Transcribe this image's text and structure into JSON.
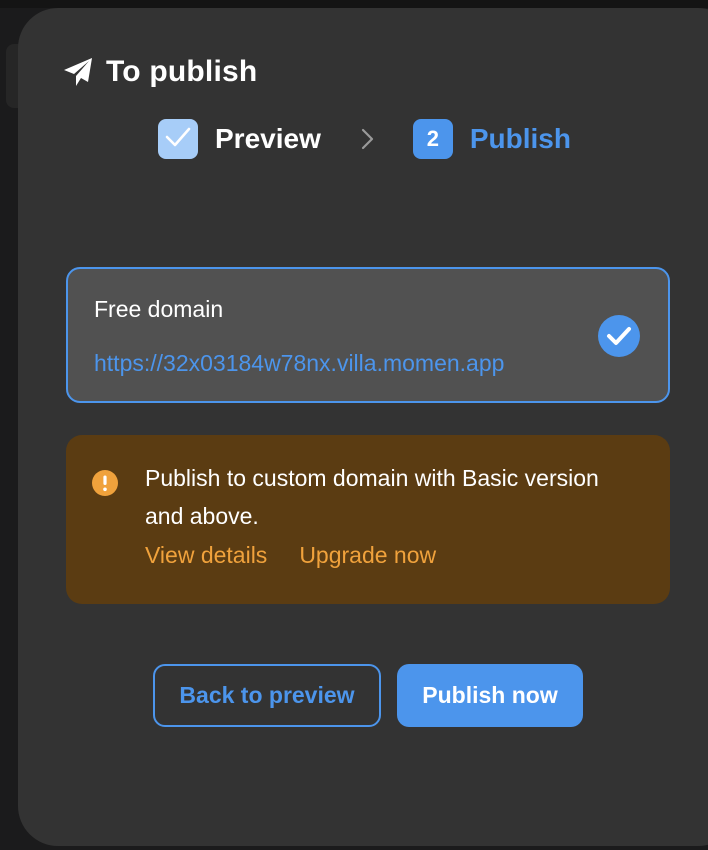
{
  "dialog": {
    "title": "To publish",
    "icon": "paper-plane-icon"
  },
  "steps": [
    {
      "label": "Preview",
      "state": "completed",
      "icon": "check-icon"
    },
    {
      "number": "2",
      "label": "Publish",
      "state": "active"
    }
  ],
  "domain_option": {
    "title": "Free domain",
    "url": "https://32x03184w78nx.villa.momen.app",
    "selected": true,
    "icon": "check-circle-icon"
  },
  "notice": {
    "icon": "warning-icon",
    "text": "Publish to custom domain with Basic version and above.",
    "links": [
      "View details",
      "Upgrade now"
    ]
  },
  "actions": {
    "back_label": "Back to preview",
    "publish_label": "Publish now"
  },
  "colors": {
    "accent": "#4c95ec",
    "modal_bg": "#333333",
    "card_bg": "#515151",
    "warning_bg": "#5b3c12",
    "warning_fg": "#f0a23c",
    "check_tile": "#a7cdf8"
  }
}
